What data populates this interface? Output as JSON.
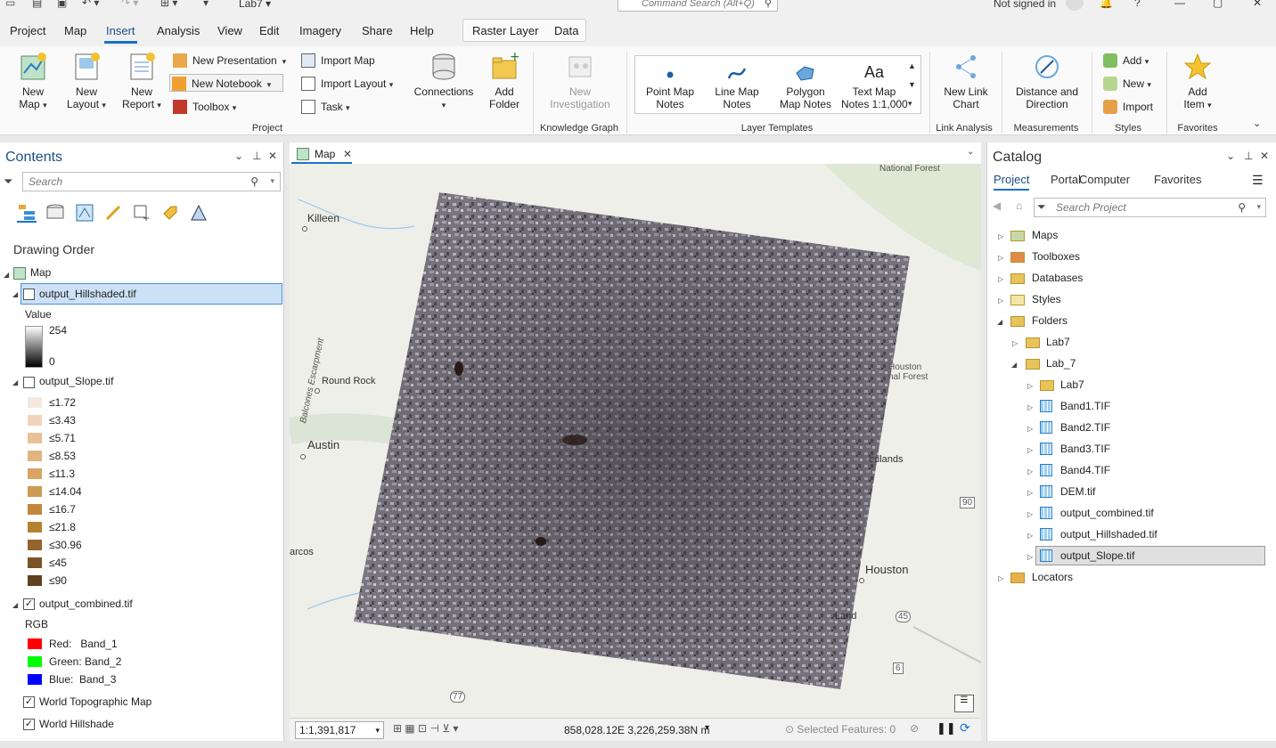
{
  "titlebar": {
    "project": "Lab7",
    "command_search_placeholder": "Command Search (Alt+Q)",
    "signed_in": "Not signed in",
    "help": "?"
  },
  "menu": {
    "tabs": [
      "Project",
      "Map",
      "Insert",
      "Analysis",
      "View",
      "Edit",
      "Imagery",
      "Share",
      "Help"
    ],
    "active": "Insert",
    "context_tabs": [
      "Raster Layer",
      "Data"
    ]
  },
  "ribbon": {
    "new_map": "New\nMap",
    "new_layout": "New\nLayout",
    "new_report": "New\nReport",
    "new_presentation": "New Presentation",
    "new_notebook": "New Notebook",
    "toolbox": "Toolbox",
    "import_map": "Import Map",
    "import_layout": "Import Layout",
    "task": "Task",
    "connections": "Connections",
    "add_folder": "Add\nFolder",
    "group_project": "Project",
    "new_investigation": "New\nInvestigation",
    "group_knowledge_graph": "Knowledge Graph",
    "point_map_notes": "Point Map\nNotes",
    "line_map_notes": "Line Map\nNotes",
    "polygon_map_notes": "Polygon\nMap Notes",
    "text_map_notes": "Text Map\nNotes 1:1,000",
    "text_glyph": "Aa",
    "group_layer_templates": "Layer Templates",
    "new_link_chart": "New Link\nChart",
    "group_link_analysis": "Link Analysis",
    "distance_direction": "Distance and\nDirection",
    "group_measurements": "Measurements",
    "add": "Add",
    "new": "New",
    "import": "Import",
    "group_styles": "Styles",
    "add_item": "Add\nItem",
    "group_favorites": "Favorites"
  },
  "contents": {
    "title": "Contents",
    "search_placeholder": "Search",
    "drawing_order": "Drawing Order",
    "map_name": "Map",
    "hillshade": {
      "name": "output_Hillshaded.tif",
      "value_label": "Value",
      "max": "254",
      "min": "0"
    },
    "slope": {
      "name": "output_Slope.tif",
      "classes": [
        {
          "label": "≤1.72",
          "color": "#f5e9df"
        },
        {
          "label": "≤3.43",
          "color": "#f0d4bc"
        },
        {
          "label": "≤5.71",
          "color": "#e8c196"
        },
        {
          "label": "≤8.53",
          "color": "#e0b57f"
        },
        {
          "label": "≤11.3",
          "color": "#d9a464"
        },
        {
          "label": "≤14.04",
          "color": "#cc9a52"
        },
        {
          "label": "≤16.7",
          "color": "#c1873b"
        },
        {
          "label": "≤21.8",
          "color": "#b4822f"
        },
        {
          "label": "≤30.96",
          "color": "#95642d"
        },
        {
          "label": "≤45",
          "color": "#7a5327"
        },
        {
          "label": "≤90",
          "color": "#5e421f"
        }
      ]
    },
    "combined": {
      "name": "output_combined.tif",
      "rgb_label": "RGB",
      "red": "Red:   Band_1",
      "green": "Green: Band_2",
      "blue": "Blue:  Band_3"
    },
    "basemap_topo": "World Topographic Map",
    "basemap_hillshade": "World Hillshade"
  },
  "mapview": {
    "tab": "Map",
    "labels": {
      "national_forest": "National Forest",
      "killeen": "Killeen",
      "round_rock": "Round Rock",
      "balcones": "Balcones Escarpment",
      "austin": "Austin",
      "houston_forest": "Houston\nnal Forest",
      "odlands": "odlands",
      "marcos": "arcos",
      "houston": "Houston",
      "land": "Land",
      "hwy90": "90",
      "hwy45": "45",
      "hwy6": "6",
      "hwy77": "77"
    },
    "scale": "1:1,391,817",
    "coordinates": "858,028.12E 3,226,259.38N m",
    "selected_features": "Selected Features: 0"
  },
  "catalog": {
    "title": "Catalog",
    "tabs": [
      "Project",
      "Portal",
      "Computer",
      "Favorites"
    ],
    "search_placeholder": "Search Project",
    "items": {
      "maps": "Maps",
      "toolboxes": "Toolboxes",
      "databases": "Databases",
      "styles": "Styles",
      "folders": "Folders",
      "lab7a": "Lab7",
      "lab_7": "Lab_7",
      "lab7b": "Lab7",
      "band1": "Band1.TIF",
      "band2": "Band2.TIF",
      "band3": "Band3.TIF",
      "band4": "Band4.TIF",
      "dem": "DEM.tif",
      "combined": "output_combined.tif",
      "hillshaded": "output_Hillshaded.tif",
      "slope": "output_Slope.tif",
      "locators": "Locators"
    }
  }
}
